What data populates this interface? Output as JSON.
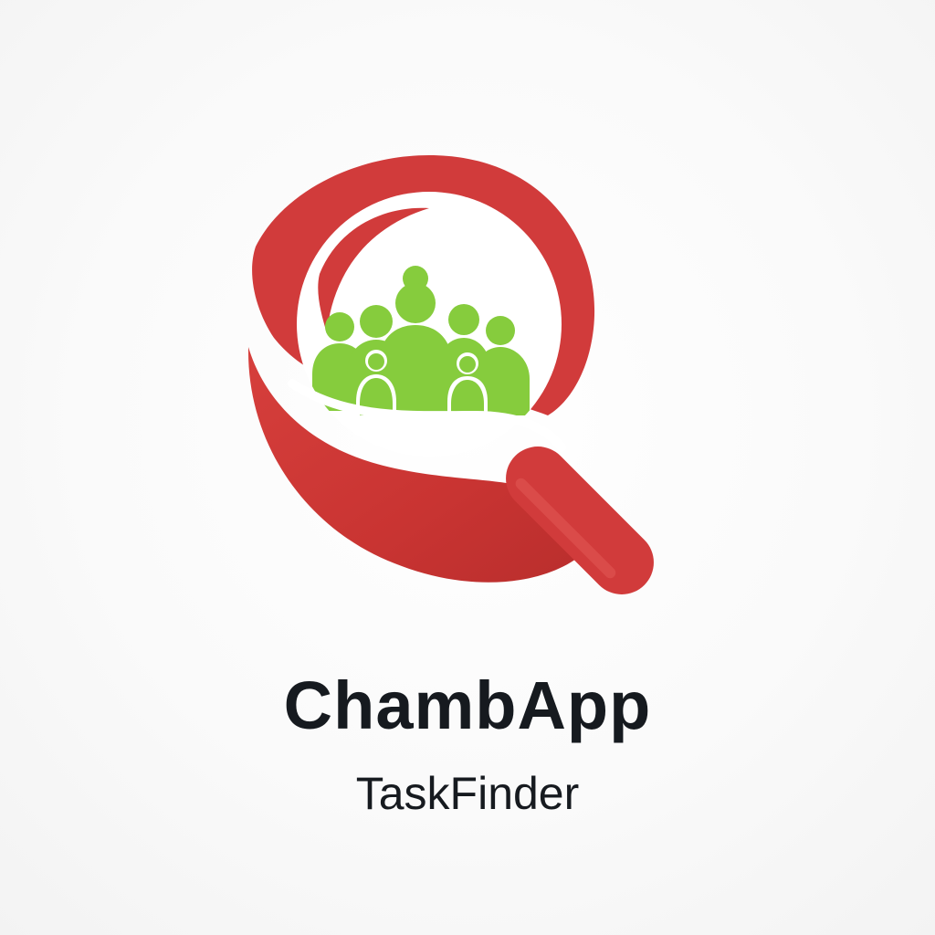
{
  "brand": {
    "name": "ChambApp",
    "tagline": "TaskFinder"
  },
  "logo": {
    "icon": "magnifying-glass-people-icon",
    "lens_color": "#d13b3b",
    "lens_shadow_color": "#b82f2f",
    "people_color": "#86cc3d"
  },
  "colors": {
    "text": "#161a1f",
    "background": "#f7f7f7"
  }
}
